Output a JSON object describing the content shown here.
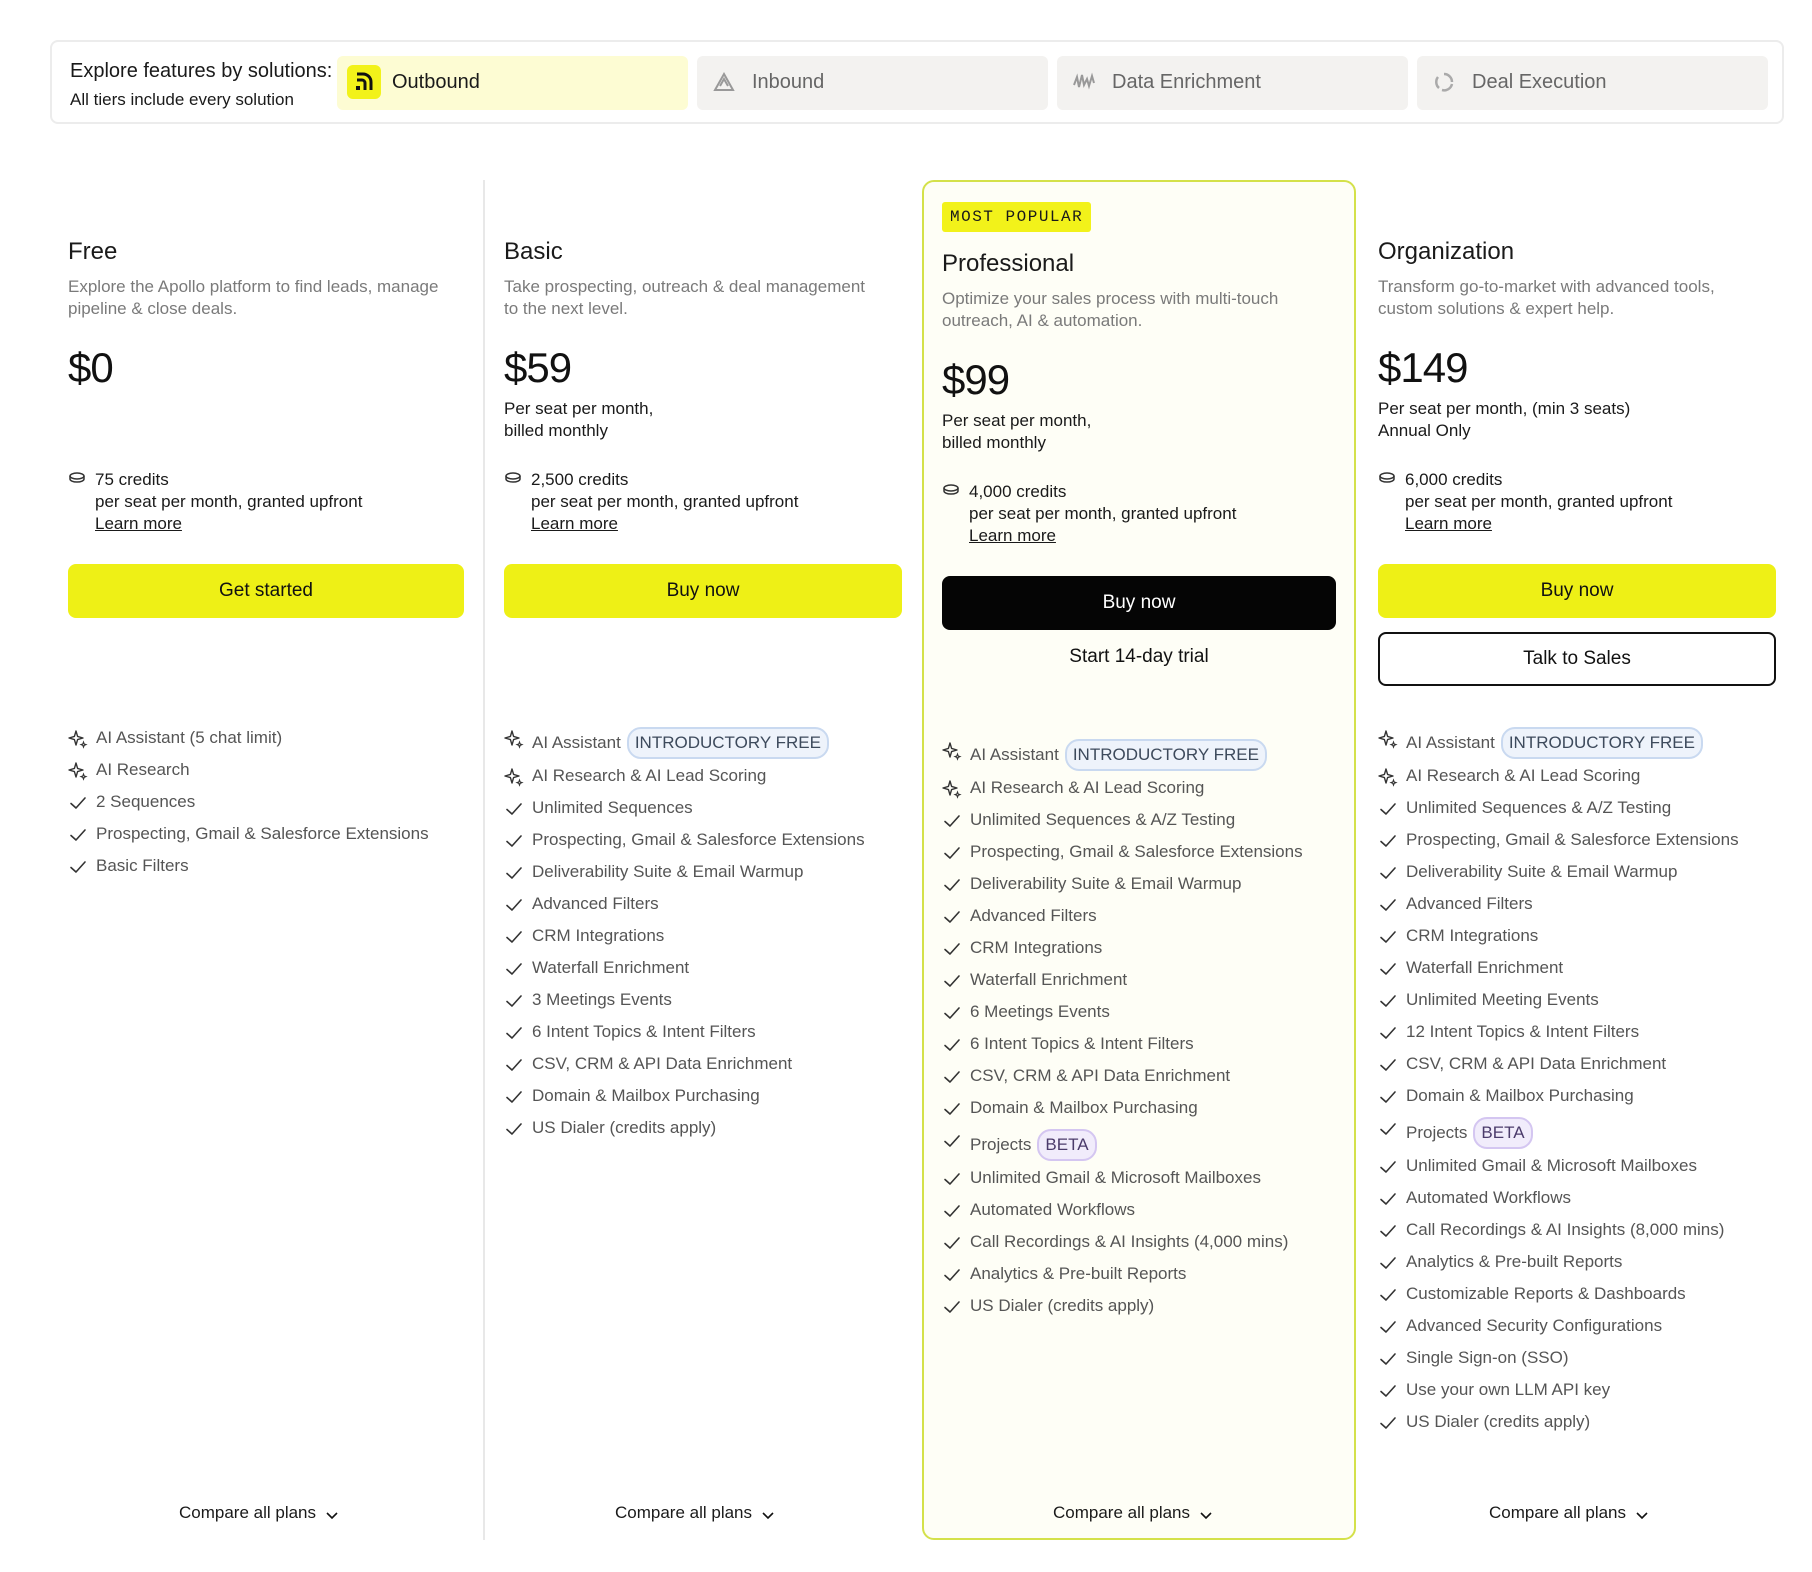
{
  "solutions": {
    "title": "Explore features by solutions:",
    "subtitle": "All tiers include every solution",
    "tabs": [
      {
        "label": "Outbound",
        "icon": "outbound-icon",
        "active": true
      },
      {
        "label": "Inbound",
        "icon": "inbound-icon",
        "active": false
      },
      {
        "label": "Data Enrichment",
        "icon": "data-enrichment-icon",
        "active": false
      },
      {
        "label": "Deal Execution",
        "icon": "deal-execution-icon",
        "active": false
      }
    ]
  },
  "plans": [
    {
      "name": "Free",
      "desc_line1": "Explore the Apollo platform to find leads, manage",
      "desc_line2": "pipeline & close deals.",
      "price": "$0",
      "billing": "",
      "credits": "75 credits",
      "credits_sub": "per seat per month, granted upfront",
      "learn_more": "Learn more",
      "primary_cta": "Get started",
      "features": [
        {
          "label": "AI Assistant (5 chat limit)",
          "icon": "sparkle-icon"
        },
        {
          "label": "AI Research",
          "icon": "sparkle-icon"
        },
        {
          "label": "2 Sequences",
          "icon": "check-icon"
        },
        {
          "label": "Prospecting, Gmail & Salesforce Extensions",
          "icon": "check-icon"
        },
        {
          "label": "Basic Filters",
          "icon": "check-icon"
        }
      ],
      "compare": "Compare all plans"
    },
    {
      "name": "Basic",
      "desc_line1": "Take prospecting, outreach & deal management",
      "desc_line2": "to the next level.",
      "price": "$59",
      "billing": "Per seat per month,\nbilled monthly",
      "credits": "2,500 credits",
      "credits_sub": "per seat per month, granted upfront",
      "learn_more": "Learn more",
      "primary_cta": "Buy now",
      "features": [
        {
          "label": "AI Assistant",
          "icon": "sparkle-icon",
          "pill": "INTRODUCTORY FREE"
        },
        {
          "label": "AI Research & AI Lead Scoring",
          "icon": "sparkle-icon"
        },
        {
          "label": "Unlimited Sequences",
          "icon": "check-icon"
        },
        {
          "label": "Prospecting, Gmail & Salesforce Extensions",
          "icon": "check-icon"
        },
        {
          "label": "Deliverability Suite & Email Warmup",
          "icon": "check-icon"
        },
        {
          "label": "Advanced Filters",
          "icon": "check-icon"
        },
        {
          "label": "CRM Integrations",
          "icon": "check-icon"
        },
        {
          "label": "Waterfall Enrichment",
          "icon": "check-icon"
        },
        {
          "label": "3 Meetings Events",
          "icon": "check-icon"
        },
        {
          "label": "6 Intent Topics & Intent Filters",
          "icon": "check-icon"
        },
        {
          "label": "CSV, CRM & API Data Enrichment",
          "icon": "check-icon"
        },
        {
          "label": "Domain & Mailbox Purchasing",
          "icon": "check-icon"
        },
        {
          "label": "US Dialer (credits apply)",
          "icon": "check-icon"
        }
      ],
      "compare": "Compare all plans"
    },
    {
      "badge": "MOST POPULAR",
      "name": "Professional",
      "desc_line1": "Optimize your sales process with multi-touch",
      "desc_line2": "outreach, AI & automation.",
      "price": "$99",
      "billing": "Per seat per month,\nbilled monthly",
      "credits": "4,000 credits",
      "credits_sub": "per seat per month, granted upfront",
      "learn_more": "Learn more",
      "primary_cta": "Buy now",
      "secondary_cta": "Start 14-day trial",
      "features": [
        {
          "label": "AI Assistant",
          "icon": "sparkle-icon",
          "pill": "INTRODUCTORY FREE"
        },
        {
          "label": "AI Research & AI Lead Scoring",
          "icon": "sparkle-icon"
        },
        {
          "label": "Unlimited Sequences & A/Z Testing",
          "icon": "check-icon"
        },
        {
          "label": "Prospecting, Gmail & Salesforce Extensions",
          "icon": "check-icon"
        },
        {
          "label": "Deliverability Suite & Email Warmup",
          "icon": "check-icon"
        },
        {
          "label": "Advanced Filters",
          "icon": "check-icon"
        },
        {
          "label": "CRM Integrations",
          "icon": "check-icon"
        },
        {
          "label": "Waterfall Enrichment",
          "icon": "check-icon"
        },
        {
          "label": "6 Meetings Events",
          "icon": "check-icon"
        },
        {
          "label": "6 Intent Topics & Intent Filters",
          "icon": "check-icon"
        },
        {
          "label": "CSV, CRM & API Data Enrichment",
          "icon": "check-icon"
        },
        {
          "label": "Domain & Mailbox Purchasing",
          "icon": "check-icon"
        },
        {
          "label": "Projects",
          "icon": "check-icon",
          "pill": "BETA"
        },
        {
          "label": "Unlimited Gmail & Microsoft Mailboxes",
          "icon": "check-icon"
        },
        {
          "label": "Automated Workflows",
          "icon": "check-icon"
        },
        {
          "label": "Call Recordings & AI Insights (4,000 mins)",
          "icon": "check-icon"
        },
        {
          "label": "Analytics & Pre-built Reports",
          "icon": "check-icon"
        },
        {
          "label": "US Dialer (credits apply)",
          "icon": "check-icon"
        }
      ],
      "compare": "Compare all plans"
    },
    {
      "name": "Organization",
      "desc_line1": "Transform go-to-market with advanced tools,",
      "desc_line2": "custom solutions & expert help.",
      "price": "$149",
      "billing": "Per seat per month, (min 3 seats)\nAnnual Only",
      "credits": "6,000 credits",
      "credits_sub": "per seat per month, granted upfront",
      "learn_more": "Learn more",
      "primary_cta": "Buy now",
      "secondary_cta": "Talk to Sales",
      "features": [
        {
          "label": "AI Assistant",
          "icon": "sparkle-icon",
          "pill": "INTRODUCTORY FREE"
        },
        {
          "label": "AI Research & AI Lead Scoring",
          "icon": "sparkle-icon"
        },
        {
          "label": "Unlimited Sequences & A/Z Testing",
          "icon": "check-icon"
        },
        {
          "label": "Prospecting, Gmail & Salesforce Extensions",
          "icon": "check-icon"
        },
        {
          "label": "Deliverability Suite & Email Warmup",
          "icon": "check-icon"
        },
        {
          "label": "Advanced Filters",
          "icon": "check-icon"
        },
        {
          "label": "CRM Integrations",
          "icon": "check-icon"
        },
        {
          "label": "Waterfall Enrichment",
          "icon": "check-icon"
        },
        {
          "label": "Unlimited Meeting Events",
          "icon": "check-icon"
        },
        {
          "label": "12 Intent Topics & Intent Filters",
          "icon": "check-icon"
        },
        {
          "label": "CSV, CRM & API Data Enrichment",
          "icon": "check-icon"
        },
        {
          "label": "Domain & Mailbox Purchasing",
          "icon": "check-icon"
        },
        {
          "label": "Projects",
          "icon": "check-icon",
          "pill": "BETA"
        },
        {
          "label": "Unlimited Gmail & Microsoft Mailboxes",
          "icon": "check-icon"
        },
        {
          "label": "Automated Workflows",
          "icon": "check-icon"
        },
        {
          "label": "Call Recordings & AI Insights (8,000 mins)",
          "icon": "check-icon"
        },
        {
          "label": "Analytics & Pre-built Reports",
          "icon": "check-icon"
        },
        {
          "label": "Customizable Reports & Dashboards",
          "icon": "check-icon"
        },
        {
          "label": "Advanced Security Configurations",
          "icon": "check-icon"
        },
        {
          "label": "Single Sign-on (SSO)",
          "icon": "check-icon"
        },
        {
          "label": "Use your own LLM API key",
          "icon": "check-icon"
        },
        {
          "label": "US Dialer (credits apply)",
          "icon": "check-icon"
        }
      ],
      "compare": "Compare all plans"
    }
  ],
  "colors": {
    "accent_yellow": "#eef016",
    "popular_border": "#d4e14a",
    "popular_bg": "#fefef6",
    "intro_pill": "#eef3fb",
    "beta_pill": "#f1ecfb"
  }
}
